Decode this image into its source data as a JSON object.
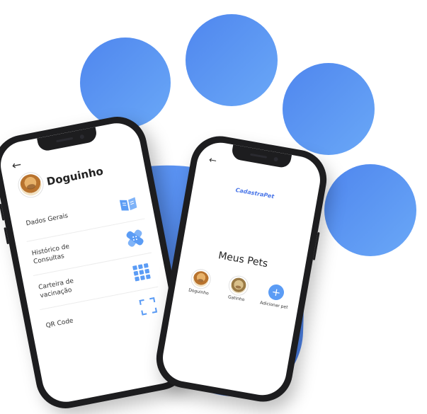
{
  "phone_profile": {
    "back_icon": "arrow-left-icon",
    "pet_name": "Doguinho",
    "menu": [
      {
        "label": "Dados Gerais",
        "icon": "book-open-icon"
      },
      {
        "label": "Histórico de Consultas",
        "icon": "bandage-icon"
      },
      {
        "label": "Carteira de vacinação",
        "icon": "grid-icon"
      },
      {
        "label": "QR Code",
        "icon": "qr-scan-icon"
      }
    ]
  },
  "phone_pets": {
    "back_icon": "arrow-left-icon",
    "brand": "CadastraPet",
    "title": "Meus Pets",
    "pets": [
      {
        "name": "Doguinho"
      },
      {
        "name": "Gatinho"
      }
    ],
    "add_label": "Adicionar pet",
    "add_symbol": "+"
  },
  "colors": {
    "accent": "#5b9cf5",
    "paw_blue": "#5b8ff0",
    "brand": "#4a76e8"
  }
}
